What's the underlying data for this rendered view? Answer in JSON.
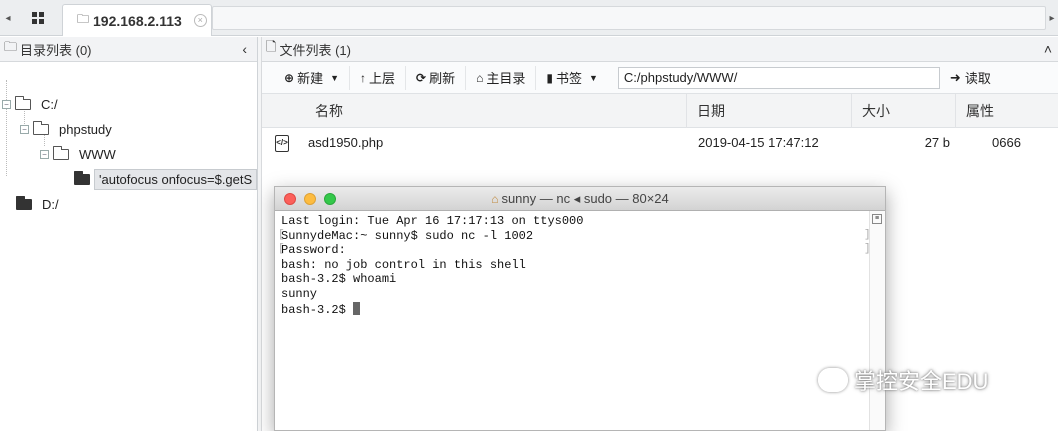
{
  "tabs": {
    "active_label": "192.168.2.113"
  },
  "directory_panel": {
    "title": "目录列表 (0)",
    "tree": {
      "drive_c": "C:/",
      "phpstudy": "phpstudy",
      "www": "WWW",
      "selected_item": "'autofocus onfocus=$.getS",
      "drive_d": "D:/"
    }
  },
  "file_panel": {
    "title": "文件列表 (1)",
    "toolbar": {
      "new_label": "新建",
      "up_label": "上层",
      "refresh_label": "刷新",
      "home_label": "主目录",
      "bookmark_label": "书签",
      "path_value": "C:/phpstudy/WWW/",
      "read_label": "读取"
    },
    "columns": {
      "name": "名称",
      "date": "日期",
      "size": "大小",
      "attr": "属性"
    },
    "rows": [
      {
        "name": "asd1950.php",
        "date": "2019-04-15 17:47:12",
        "size": "27 b",
        "attr": "0666"
      }
    ]
  },
  "terminal": {
    "title": "sunny — nc ◂ sudo — 80×24",
    "lines": [
      "Last login: Tue Apr 16 17:17:13 on ttys000",
      "SunnydeMac:~ sunny$ sudo nc -l 1002",
      "Password:",
      "bash: no job control in this shell",
      "bash-3.2$ whoami",
      "sunny"
    ],
    "prompt": "bash-3.2$ "
  },
  "watermark": {
    "text": "掌控安全EDU"
  },
  "colors": {
    "close_light": "#fc605b",
    "minimize_light": "#fdbc40",
    "zoom_light": "#34c84a"
  }
}
